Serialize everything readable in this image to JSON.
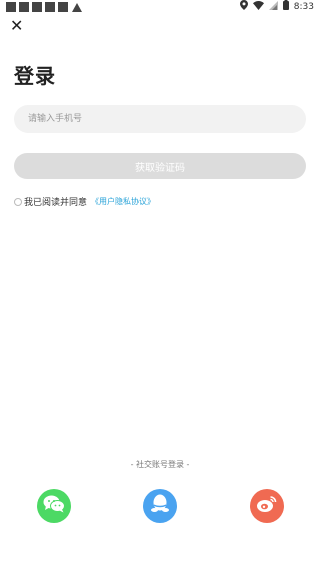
{
  "status_bar": {
    "time": "8:33"
  },
  "header": {
    "close_icon": "close-icon"
  },
  "page": {
    "title": "登录"
  },
  "form": {
    "phone_placeholder": "请输入手机号",
    "get_code_label": "获取验证码",
    "agree_text": "我已阅读并同意",
    "agreement_link": "《用户隐私协议》"
  },
  "social": {
    "title": "- 社交账号登录 -",
    "providers": [
      "wechat",
      "qq",
      "weibo"
    ]
  },
  "colors": {
    "wechat": "#4cd964",
    "qq": "#4aa3f0",
    "weibo": "#f06a52",
    "link": "#2aa3d8"
  }
}
